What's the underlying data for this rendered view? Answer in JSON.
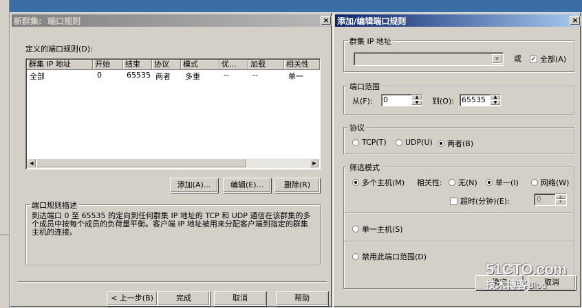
{
  "wizard": {
    "title": "新群集:  端口规则",
    "close_label": "×",
    "defined_rules_label": "定义的端口规则(D):",
    "columns": [
      "群集 IP 地址",
      "开始",
      "结束",
      "协议",
      "模式",
      "优...",
      "加载",
      "相关性"
    ],
    "rows": [
      [
        "全部",
        "0",
        "65535",
        "两者",
        "多重",
        "--",
        "--",
        "单一"
      ]
    ],
    "add_button": "添加(A)...",
    "edit_button": "编辑(E)...",
    "delete_button": "删除(R)",
    "description_group": "端口规则描述",
    "description_text": "到达端口 0 至 65535 的定向到任何群集 IP 地址的 TCP 和 UDP 通信在该群集的多个成员中按每个成员的负荷量平衡。客户端 IP 地址被用来分配客户端到指定的群集主机的连接。",
    "back_button": "< 上一步(B)",
    "finish_button": "完成",
    "cancel_button": "取消",
    "help_button": "帮助"
  },
  "dialog": {
    "title": "添加/编辑端口规则",
    "close_label": "×",
    "cluster_ip_group": "群集 IP 地址",
    "cluster_ip_value": "",
    "or_label": "或",
    "all_label": "全部(A)",
    "all_checked": true,
    "port_range_group": "端口范围",
    "from_label": "从(F):",
    "from_value": "0",
    "to_label": "到(O):",
    "to_value": "65535",
    "protocol_group": "协议",
    "protocol_tcp": "TCP(T)",
    "protocol_udp": "UDP(U)",
    "protocol_both": "两者(B)",
    "filter_group": "筛选模式",
    "multi_host": "多个主机(M)",
    "affinity_label": "相关性:",
    "affinity_none": "无(N)",
    "affinity_single": "单一(I)",
    "affinity_network": "网络(W)",
    "timeout_label": "超时(分钟)(E):",
    "timeout_value": "0",
    "single_host": "单一主机(S)",
    "disable_range": "禁用此端口范围(D)",
    "ok_button": "确定",
    "cancel_button": "取消"
  },
  "watermark": {
    "site": "51CTO.com",
    "tagline": "技术博客",
    "suffix": "Blog"
  }
}
